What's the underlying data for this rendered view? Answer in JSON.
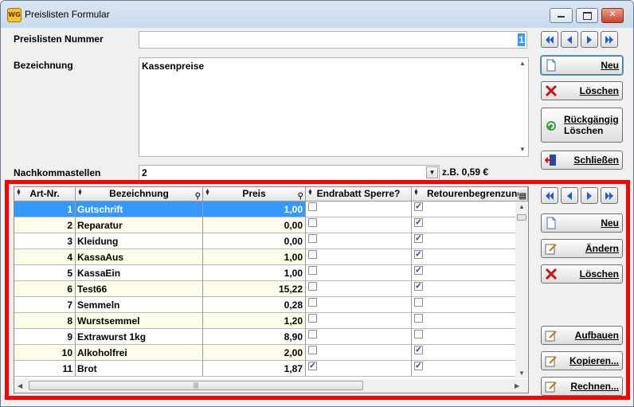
{
  "window": {
    "title": "Preislisten Formular",
    "app_icon": "WG"
  },
  "form": {
    "nummer_label": "Preislisten Nummer",
    "nummer_value": "1",
    "bezeichnung_label": "Bezeichnung",
    "bezeichnung_value": "Kassenpreise",
    "nachkomma_label": "Nachkommastellen",
    "nachkomma_value": "2",
    "example_text": "z.B. 0,59 €"
  },
  "buttons": {
    "neu": "Neu",
    "loeschen": "Löschen",
    "rueckgaengig_1": "Rückgängig",
    "rueckgaengig_2": "Löschen",
    "schliessen": "Schließen"
  },
  "grid": {
    "columns": [
      "Art-Nr.",
      "Bezeichnung",
      "Preis",
      "Endrabatt Sperre?",
      "Retourenbegrenzung"
    ],
    "rows": [
      {
        "nr": "1",
        "bez": "Gutschrift",
        "preis": "1,00",
        "endrabatt": false,
        "retoure": true,
        "selected": true
      },
      {
        "nr": "2",
        "bez": "Reparatur",
        "preis": "0,00",
        "endrabatt": false,
        "retoure": true
      },
      {
        "nr": "3",
        "bez": "Kleidung",
        "preis": "0,00",
        "endrabatt": false,
        "retoure": true
      },
      {
        "nr": "4",
        "bez": "KassaAus",
        "preis": "1,00",
        "endrabatt": false,
        "retoure": true
      },
      {
        "nr": "5",
        "bez": "KassaEin",
        "preis": "1,00",
        "endrabatt": false,
        "retoure": true
      },
      {
        "nr": "6",
        "bez": "Test66",
        "preis": "15,22",
        "endrabatt": false,
        "retoure": true
      },
      {
        "nr": "7",
        "bez": "Semmeln",
        "preis": "0,28",
        "endrabatt": false,
        "retoure": false
      },
      {
        "nr": "8",
        "bez": "Wurstsemmel",
        "preis": "1,20",
        "endrabatt": false,
        "retoure": false
      },
      {
        "nr": "9",
        "bez": "Extrawurst 1kg",
        "preis": "8,90",
        "endrabatt": false,
        "retoure": false
      },
      {
        "nr": "10",
        "bez": "Alkoholfrei",
        "preis": "2,00",
        "endrabatt": false,
        "retoure": true
      },
      {
        "nr": "11",
        "bez": "Brot",
        "preis": "1,87",
        "endrabatt": true,
        "retoure": true
      }
    ],
    "buttons": {
      "neu": "Neu",
      "aendern": "Ändern",
      "loeschen": "Löschen",
      "aufbauen": "Aufbauen",
      "kopieren": "Kopieren...",
      "rechnen": "Rechnen..."
    }
  },
  "colors": {
    "selection": "#3399ff",
    "highlight_border": "#ff0000",
    "row_alt": "#fdfde8"
  }
}
